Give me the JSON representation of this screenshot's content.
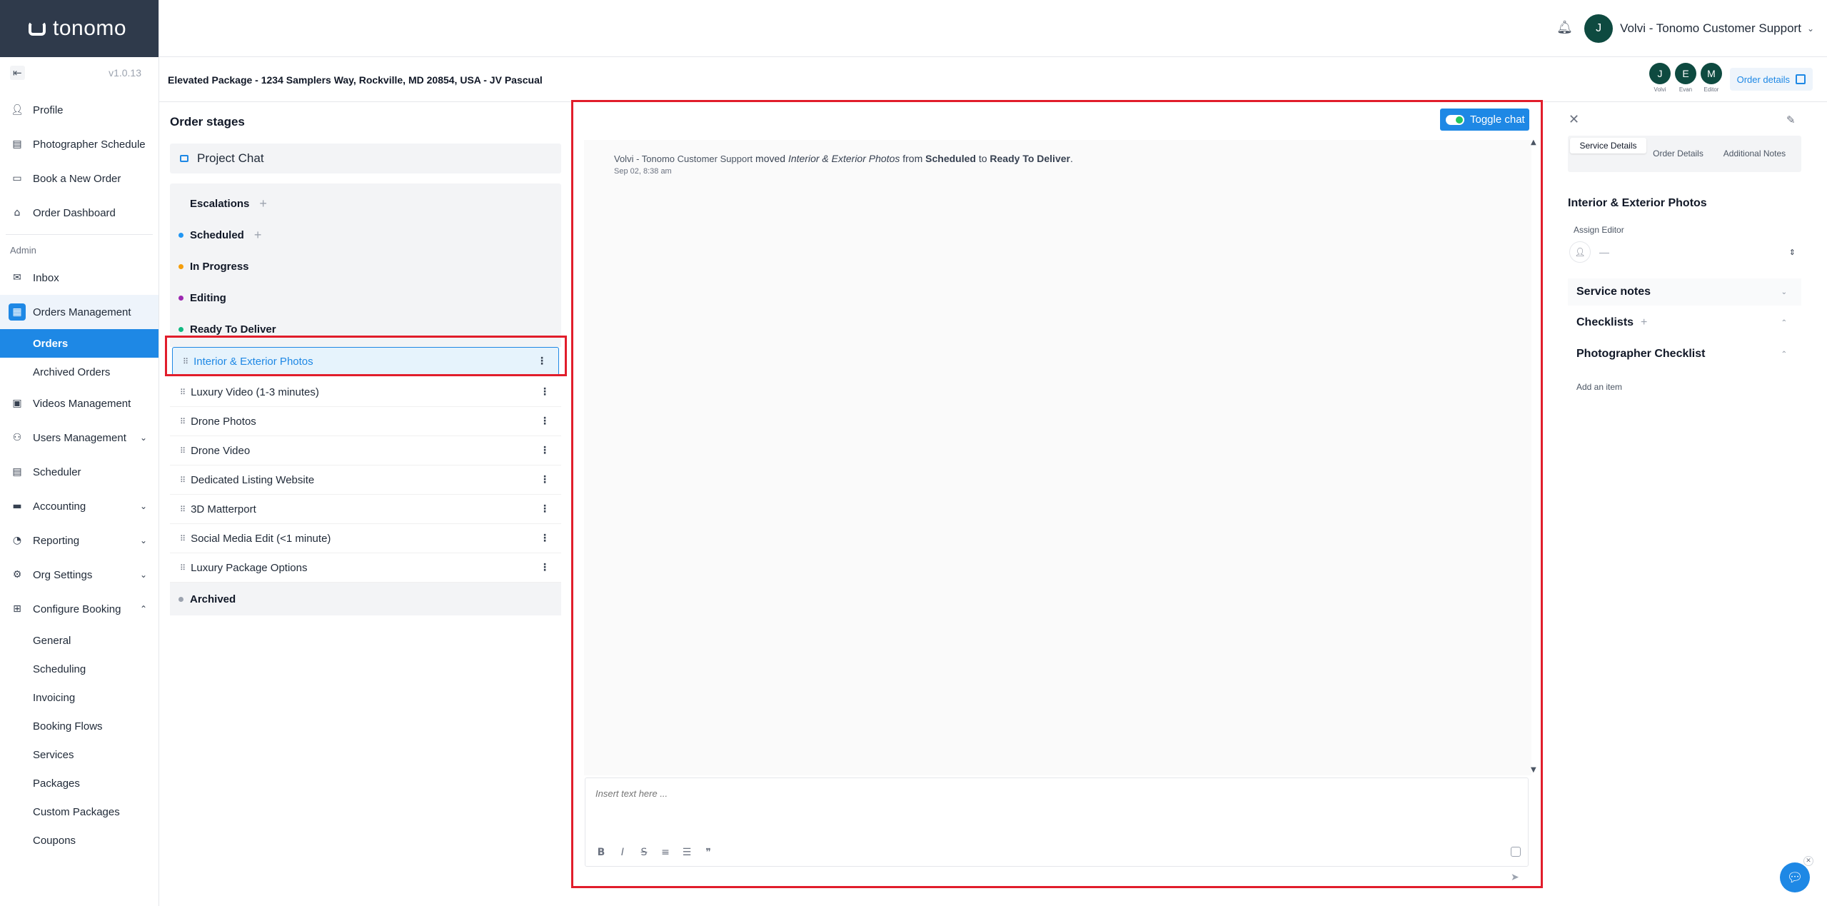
{
  "app": {
    "logo_text": "tonomo",
    "version": "v1.0.13"
  },
  "sidebar": {
    "items_top": [
      {
        "label": "Profile",
        "icon": "user-icon"
      },
      {
        "label": "Photographer Schedule",
        "icon": "calendar-icon"
      },
      {
        "label": "Book a New Order",
        "icon": "document-icon"
      },
      {
        "label": "Order Dashboard",
        "icon": "home-icon"
      }
    ],
    "admin_label": "Admin",
    "inbox_label": "Inbox",
    "orders_management_label": "Orders Management",
    "orders_label": "Orders",
    "archived_orders_label": "Archived Orders",
    "videos_management_label": "Videos Management",
    "users_management_label": "Users Management",
    "scheduler_label": "Scheduler",
    "accounting_label": "Accounting",
    "reporting_label": "Reporting",
    "org_settings_label": "Org Settings",
    "configure_booking_label": "Configure Booking",
    "configure_booking_items": [
      "General",
      "Scheduling",
      "Invoicing",
      "Booking Flows",
      "Services",
      "Packages",
      "Custom Packages",
      "Coupons"
    ]
  },
  "header": {
    "user_initial": "J",
    "user_name": "Volvi - Tonomo Customer Support"
  },
  "order": {
    "title": "Elevated Package - 1234 Samplers Way, Rockville, MD 20854, USA - JV Pascual",
    "team": [
      {
        "initial": "J",
        "role": "Volvi"
      },
      {
        "initial": "E",
        "role": "Evan"
      },
      {
        "initial": "M",
        "role": "Editor"
      }
    ],
    "details_button": "Order details"
  },
  "stages": {
    "title": "Order stages",
    "project_chat": "Project Chat",
    "escalations": "Escalations",
    "scheduled": "Scheduled",
    "in_progress": "In Progress",
    "editing": "Editing",
    "ready_to_deliver": "Ready To Deliver",
    "services": [
      "Interior & Exterior Photos",
      "Luxury Video (1-3 minutes)",
      "Drone Photos",
      "Drone Video",
      "Dedicated Listing Website",
      "3D Matterport",
      "Social Media Edit (<1 minute)",
      "Luxury Package Options"
    ],
    "archived": "Archived",
    "colors": {
      "scheduled": "#2196f3",
      "in_progress": "#f59e0b",
      "editing": "#9c27b0",
      "ready_to_deliver": "#10b981",
      "archived": "#9ca3af"
    }
  },
  "chat": {
    "toggle_label": "Toggle chat",
    "message": {
      "who": "Volvi - Tonomo Customer Support",
      "moved": "moved",
      "item": "Interior & Exterior Photos",
      "from": "from",
      "from_stage": "Scheduled",
      "to": "to",
      "to_stage": "Ready To Deliver",
      "end": ".",
      "time": "Sep 02, 8:38 am"
    },
    "placeholder": "Insert text here ..."
  },
  "details": {
    "tabs": [
      "Service Details",
      "Order Details",
      "Additional Notes"
    ],
    "service_title": "Interior & Exterior Photos",
    "assign_label": "Assign Editor",
    "assign_value": "—",
    "service_notes": "Service notes",
    "checklists": "Checklists",
    "photographer_checklist": "Photographer Checklist",
    "add_item": "Add an item"
  },
  "accent_color": "#1e88e5",
  "highlight_color": "#e11d2b"
}
